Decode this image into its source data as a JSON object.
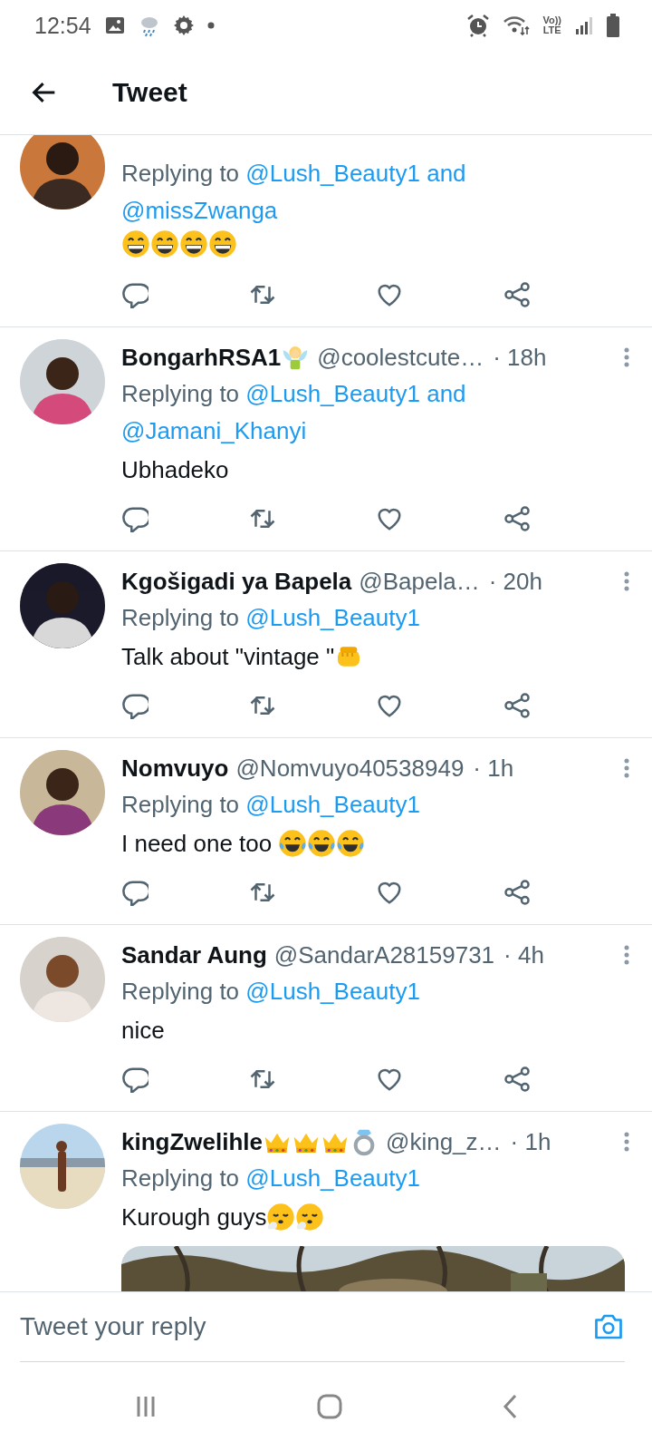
{
  "status_bar": {
    "time": "12:54",
    "network_top": "Vo))",
    "network_bottom": "LTE"
  },
  "app_bar": {
    "title": "Tweet"
  },
  "tweets": [
    {
      "reply": {
        "prefix": "Replying to",
        "mentions": [
          "@Lush_Beauty1 and",
          "@missZwanga"
        ]
      },
      "body_emoji": [
        {
          "kind": "grin"
        },
        {
          "kind": "grin"
        },
        {
          "kind": "grin"
        },
        {
          "kind": "grin"
        }
      ]
    },
    {
      "author": {
        "name": "BongarhRSA1",
        "name_emoji": [
          {
            "kind": "fairy"
          }
        ],
        "handle": "@coolestcute…",
        "time": "· 18h"
      },
      "reply": {
        "prefix": "Replying to",
        "mentions": [
          "@Lush_Beauty1 and",
          "@Jamani_Khanyi"
        ]
      },
      "body": "Ubhadeko"
    },
    {
      "author": {
        "name": "Kgošigadi ya Bapela",
        "handle": "@Bapela…",
        "time": "· 20h"
      },
      "reply": {
        "prefix": "Replying to",
        "mentions": [
          "@Lush_Beauty1"
        ]
      },
      "body": "Talk about \"vintage \"",
      "body_emoji": [
        {
          "kind": "fist"
        }
      ]
    },
    {
      "author": {
        "name": "Nomvuyo",
        "handle": "@Nomvuyo40538949",
        "time": "· 1h"
      },
      "reply": {
        "prefix": "Replying to",
        "mentions": [
          "@Lush_Beauty1"
        ]
      },
      "body": "I need one too ",
      "body_emoji": [
        {
          "kind": "joy"
        },
        {
          "kind": "joy"
        },
        {
          "kind": "joy"
        }
      ]
    },
    {
      "author": {
        "name": "Sandar Aung",
        "handle": "@SandarA28159731",
        "time": "· 4h"
      },
      "reply": {
        "prefix": "Replying to",
        "mentions": [
          "@Lush_Beauty1"
        ]
      },
      "body": "nice"
    },
    {
      "author": {
        "name": "kingZwelihle",
        "name_emoji": [
          {
            "kind": "crown"
          },
          {
            "kind": "crown"
          },
          {
            "kind": "crown"
          },
          {
            "kind": "ring"
          }
        ],
        "handle": "@king_z…",
        "time": "· 1h"
      },
      "reply": {
        "prefix": "Replying to",
        "mentions": [
          "@Lush_Beauty1"
        ]
      },
      "body": "Kurough guys",
      "body_emoji": [
        {
          "kind": "exhale"
        },
        {
          "kind": "exhale"
        }
      ],
      "media": {
        "kind": "picture"
      }
    }
  ],
  "composer": {
    "placeholder": "Tweet your reply"
  }
}
